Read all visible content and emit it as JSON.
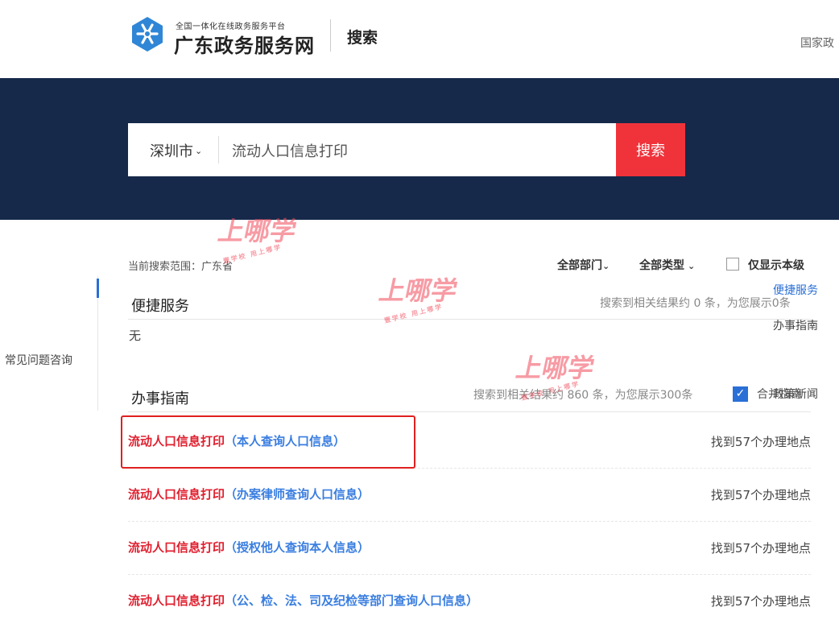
{
  "header": {
    "logo_small": "全国一体化在线政务服务平台",
    "logo_big": "广东政务服务网",
    "search_label": "搜索",
    "right_link": "国家政"
  },
  "search": {
    "city": "深圳市",
    "query": "流动人口信息打印",
    "button": "搜索"
  },
  "sidenav": {
    "items": [
      {
        "label": "便捷服务",
        "active": true
      },
      {
        "label": "办事指南",
        "active": false
      },
      {
        "label": "常见问题咨询",
        "active": false
      },
      {
        "label": "政策新闻",
        "active": false
      }
    ]
  },
  "filters": {
    "scope": "当前搜索范围：广东省",
    "department": "全部部门",
    "type": "全部类型",
    "only_level": "仅显示本级"
  },
  "sections": {
    "service": {
      "title": "便捷服务",
      "count": "搜索到相关结果约 0 条，为您展示0条",
      "empty": "无"
    },
    "guide": {
      "title": "办事指南",
      "count": "搜索到相关结果约 860 条，为您展示300条",
      "merge": "合并指南"
    }
  },
  "results": [
    {
      "keyword": "流动人口信息打印",
      "qualifier": "（本人查询人口信息）",
      "locations": "找到57个办理地点"
    },
    {
      "keyword": "流动人口信息打印",
      "qualifier": "（办案律师查询人口信息）",
      "locations": "找到57个办理地点"
    },
    {
      "keyword": "流动人口信息打印",
      "qualifier": "（授权他人查询本人信息）",
      "locations": "找到57个办理地点"
    },
    {
      "keyword": "流动人口信息打印",
      "qualifier": "（公、检、法、司及纪检等部门查询人口信息）",
      "locations": "找到57个办理地点"
    }
  ],
  "watermark": {
    "big": "上哪学",
    "small": "壹学校 用上哪学"
  },
  "colors": {
    "banner": "#16294a",
    "accent": "#f0333b",
    "link_blue": "#3a7ee0",
    "nav_blue": "#2a6fd6"
  }
}
